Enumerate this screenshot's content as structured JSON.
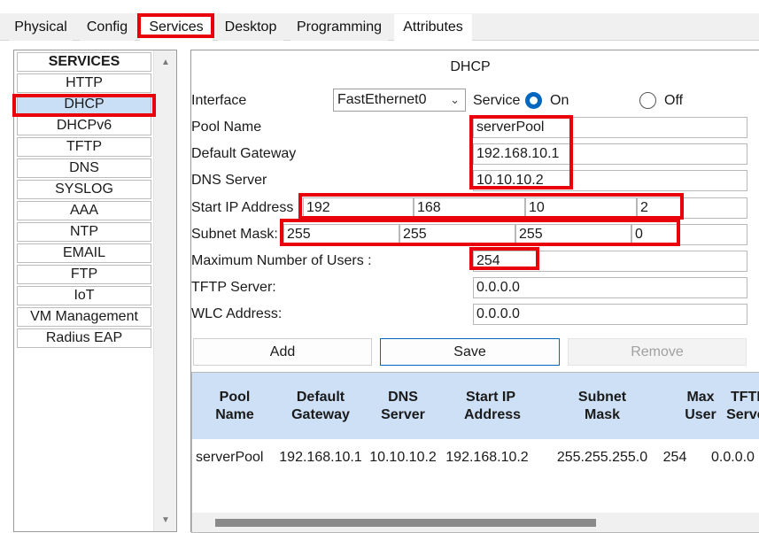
{
  "tabs": [
    {
      "label": "Physical"
    },
    {
      "label": "Config"
    },
    {
      "label": "Services"
    },
    {
      "label": "Desktop"
    },
    {
      "label": "Programming"
    },
    {
      "label": "Attributes"
    }
  ],
  "services_list": {
    "header": "SERVICES",
    "items": [
      "HTTP",
      "DHCP",
      "DHCPv6",
      "TFTP",
      "DNS",
      "SYSLOG",
      "AAA",
      "NTP",
      "EMAIL",
      "FTP",
      "IoT",
      "VM Management",
      "Radius EAP"
    ],
    "selected": "DHCP"
  },
  "dhcp": {
    "title": "DHCP",
    "interface_label": "Interface",
    "interface_value": "FastEthernet0",
    "service_label": "Service",
    "on_label": "On",
    "off_label": "Off",
    "service_state": "On",
    "pool_name_label": "Pool Name",
    "pool_name_value": "serverPool",
    "gateway_label": "Default Gateway",
    "gateway_value": "192.168.10.1",
    "dns_label": "DNS Server",
    "dns_value": "10.10.10.2",
    "start_ip_label": "Start IP Address :",
    "start_ip": [
      "192",
      "168",
      "10",
      "2"
    ],
    "subnet_label": "Subnet Mask:",
    "subnet": [
      "255",
      "255",
      "255",
      "0"
    ],
    "max_users_label": "Maximum Number of Users :",
    "max_users_value": "254",
    "tftp_label": "TFTP Server:",
    "tftp_value": "0.0.0.0",
    "wlc_label": "WLC Address:",
    "wlc_value": "0.0.0.0",
    "add_label": "Add",
    "save_label": "Save",
    "remove_label": "Remove"
  },
  "table": {
    "headers": [
      "Pool Name",
      "Default Gateway",
      "DNS Server",
      "Start IP Address",
      "Subnet Mask",
      "Max User",
      "TFTP Server"
    ],
    "rows": [
      [
        "serverPool",
        "192.168.10.1",
        "10.10.10.2",
        "192.168.10.2",
        "255.255.255.0",
        "254",
        "0.0.0.0"
      ]
    ]
  },
  "colors": {
    "highlight_red": "#e8000b",
    "accent_blue": "#0067c0",
    "selected_bg": "#c9dff5",
    "table_header_bg": "#cde0f5"
  }
}
